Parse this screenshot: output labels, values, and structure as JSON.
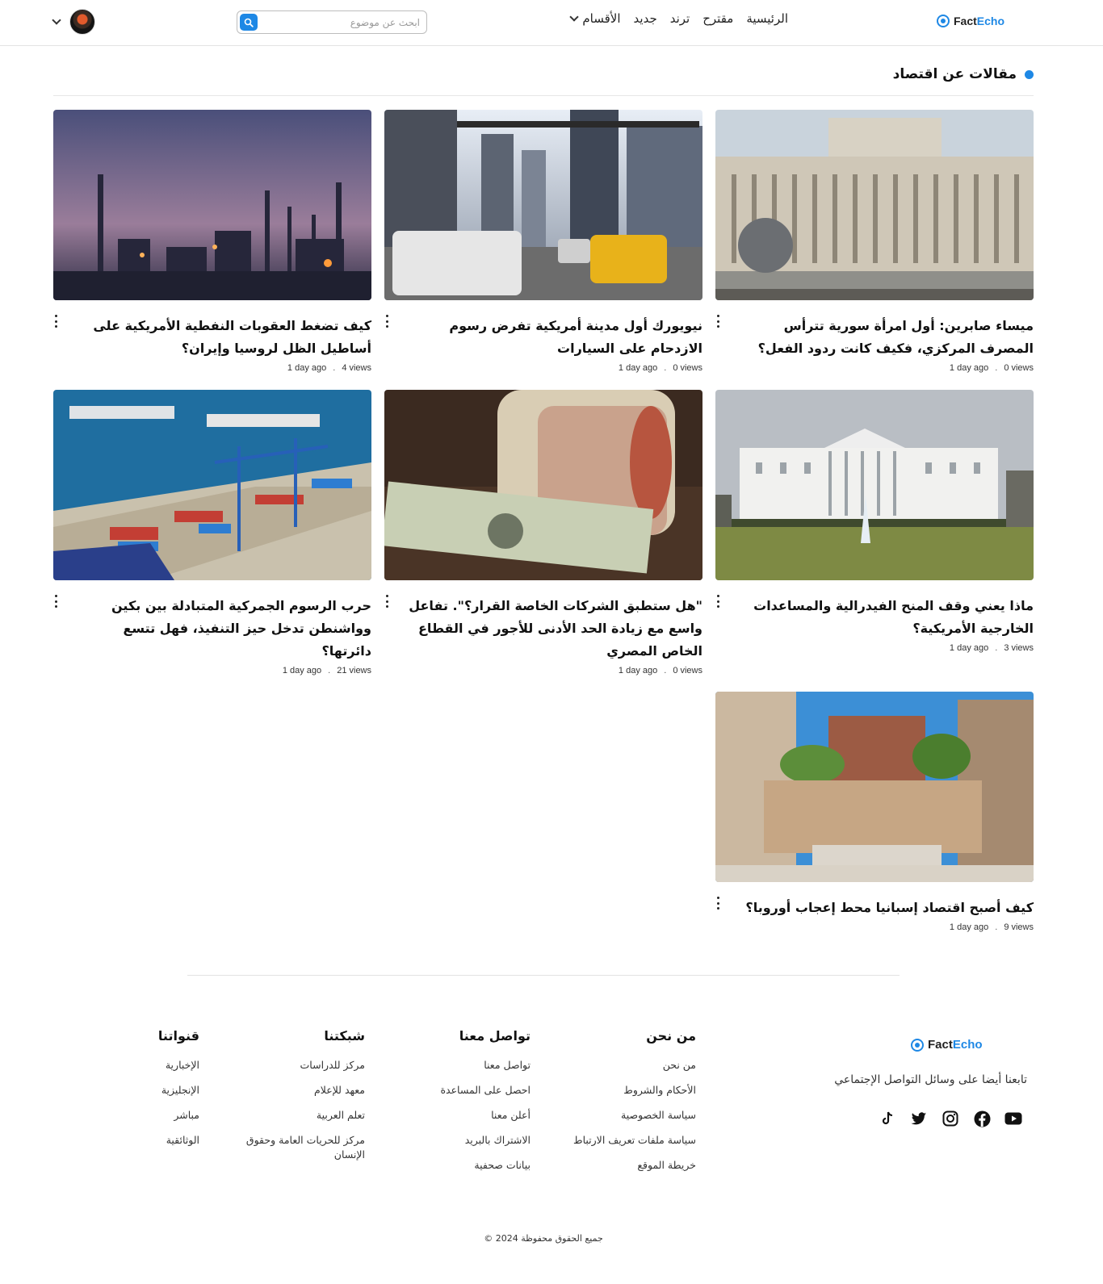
{
  "brand": {
    "fact": "Fact",
    "echo": "Echo"
  },
  "nav": {
    "home": "الرئيسية",
    "suggested": "مقترح",
    "trend": "ترند",
    "new": "جديد",
    "sections": "الأقسام"
  },
  "search": {
    "placeholder": "ابحث عن موضوع"
  },
  "section": {
    "title": "مقالات عن اقتصاد"
  },
  "articles": [
    {
      "title": "ميساء صابرين: أول امرأة سورية تترأس المصرف المركزي، فكيف كانت ردود الفعل؟",
      "time": "1 day ago",
      "views": "0 views",
      "image": "central-bank-building"
    },
    {
      "title": "نيويورك أول مدينة أمريكية تفرض رسوم الازدحام على السيارات",
      "time": "1 day ago",
      "views": "0 views",
      "image": "new-york-traffic"
    },
    {
      "title": "كيف تضغط العقوبات النفطية الأمريكية على أساطيل الظل لروسيا وإيران؟",
      "time": "1 day ago",
      "views": "4 views",
      "image": "oil-refinery-dusk"
    },
    {
      "title": "ماذا يعني وقف المنح الفيدرالية والمساعدات الخارجية الأمريكية؟",
      "time": "1 day ago",
      "views": "3 views",
      "image": "white-house"
    },
    {
      "title": "\"هل ستطبق الشركات الخاصة القرار؟\". تفاعل واسع مع زيادة الحد الأدنى للأجور في القطاع الخاص المصري",
      "time": "1 day ago",
      "views": "0 views",
      "image": "egyptian-pounds-and-dollars"
    },
    {
      "title": "حرب الرسوم الجمركية المتبادلة بين بكين وواشنطن تدخل حيز التنفيذ، فهل تتسع دائرتها؟",
      "time": "1 day ago",
      "views": "21 views",
      "image": "container-port"
    },
    {
      "title": "كيف أصبح اقتصاد إسبانيا محط إعجاب أوروبا؟",
      "time": "1 day ago",
      "views": "9 views",
      "image": "spanish-plaza"
    }
  ],
  "meta_sep": ".",
  "footer": {
    "follow": "تابعنا أيضا على وسائل التواصل الإجتماعي",
    "about": {
      "title": "من نحن",
      "links": [
        "من نحن",
        "الأحكام والشروط",
        "سياسة الخصوصية",
        "سياسة ملفات تعريف الارتباط",
        "خريطة الموقع"
      ]
    },
    "contact": {
      "title": "تواصل معنا",
      "links": [
        "تواصل معنا",
        "احصل على المساعدة",
        "أعلن معنا",
        "الاشتراك بالبريد",
        "بيانات صحفية"
      ]
    },
    "network": {
      "title": "شبكتنا",
      "links": [
        "مركز للدراسات",
        "معهد للإعلام",
        "تعلم العربية",
        "مركز للحريات العامة وحقوق الإنسان"
      ]
    },
    "channels": {
      "title": "قنواتنا",
      "links": [
        "الإخبارية",
        "الإنجليزية",
        "مباشر",
        "الوثائقية"
      ]
    },
    "socials": [
      "youtube-icon",
      "facebook-icon",
      "instagram-icon",
      "twitter-icon",
      "tiktok-icon"
    ],
    "copyright": "© 2024 جميع الحقوق محفوظة"
  },
  "colors": {
    "accent": "#1e88e5"
  }
}
